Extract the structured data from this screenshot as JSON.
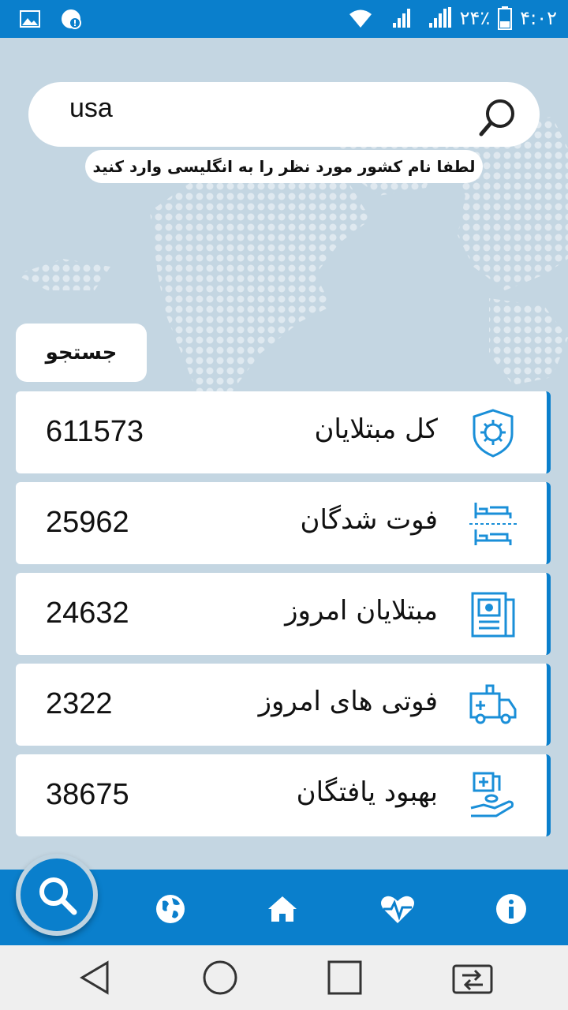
{
  "status_bar": {
    "battery": "۲۴٪",
    "time": "۴:۰۲",
    "icons": [
      "gallery-icon",
      "alert-icon",
      "wifi-icon",
      "signal-1-icon",
      "signal-2-icon",
      "battery-icon"
    ]
  },
  "search": {
    "value": "usa",
    "hint": "لطفا نام کشور مورد نظر را به انگلیسی وارد کنید",
    "button_label": "جستجو"
  },
  "stats": [
    {
      "label": "کل مبتلایان",
      "value": "611573",
      "icon": "shield-virus-icon"
    },
    {
      "label": "فوت شدگان",
      "value": "25962",
      "icon": "beds-icon"
    },
    {
      "label": "مبتلایان امروز",
      "value": "24632",
      "icon": "report-icon"
    },
    {
      "label": "فوتی های امروز",
      "value": "2322",
      "icon": "ambulance-icon"
    },
    {
      "label": "بهبود یافتگان",
      "value": "38675",
      "icon": "hand-medicine-icon"
    }
  ],
  "bottom_nav": [
    "search-icon",
    "globe-icon",
    "home-icon",
    "heartbeat-icon",
    "info-icon"
  ],
  "colors": {
    "primary": "#0a7fcc",
    "background": "#c4d6e2"
  }
}
